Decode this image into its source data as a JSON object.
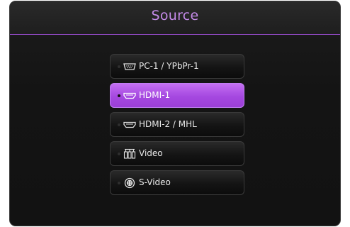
{
  "header": {
    "title": "Source"
  },
  "colors": {
    "accent": "#b366ec",
    "title": "#c48ae8",
    "panel": "#161616"
  },
  "sources": [
    {
      "label": "PC-1 / YPbPr-1",
      "icon": "vga-port-icon",
      "selected": false
    },
    {
      "label": "HDMI-1",
      "icon": "hdmi-port-icon",
      "selected": true
    },
    {
      "label": "HDMI-2 / MHL",
      "icon": "hdmi-port-icon",
      "selected": false
    },
    {
      "label": "Video",
      "icon": "composite-video-icon",
      "selected": false
    },
    {
      "label": "S-Video",
      "icon": "s-video-port-icon",
      "selected": false
    }
  ]
}
